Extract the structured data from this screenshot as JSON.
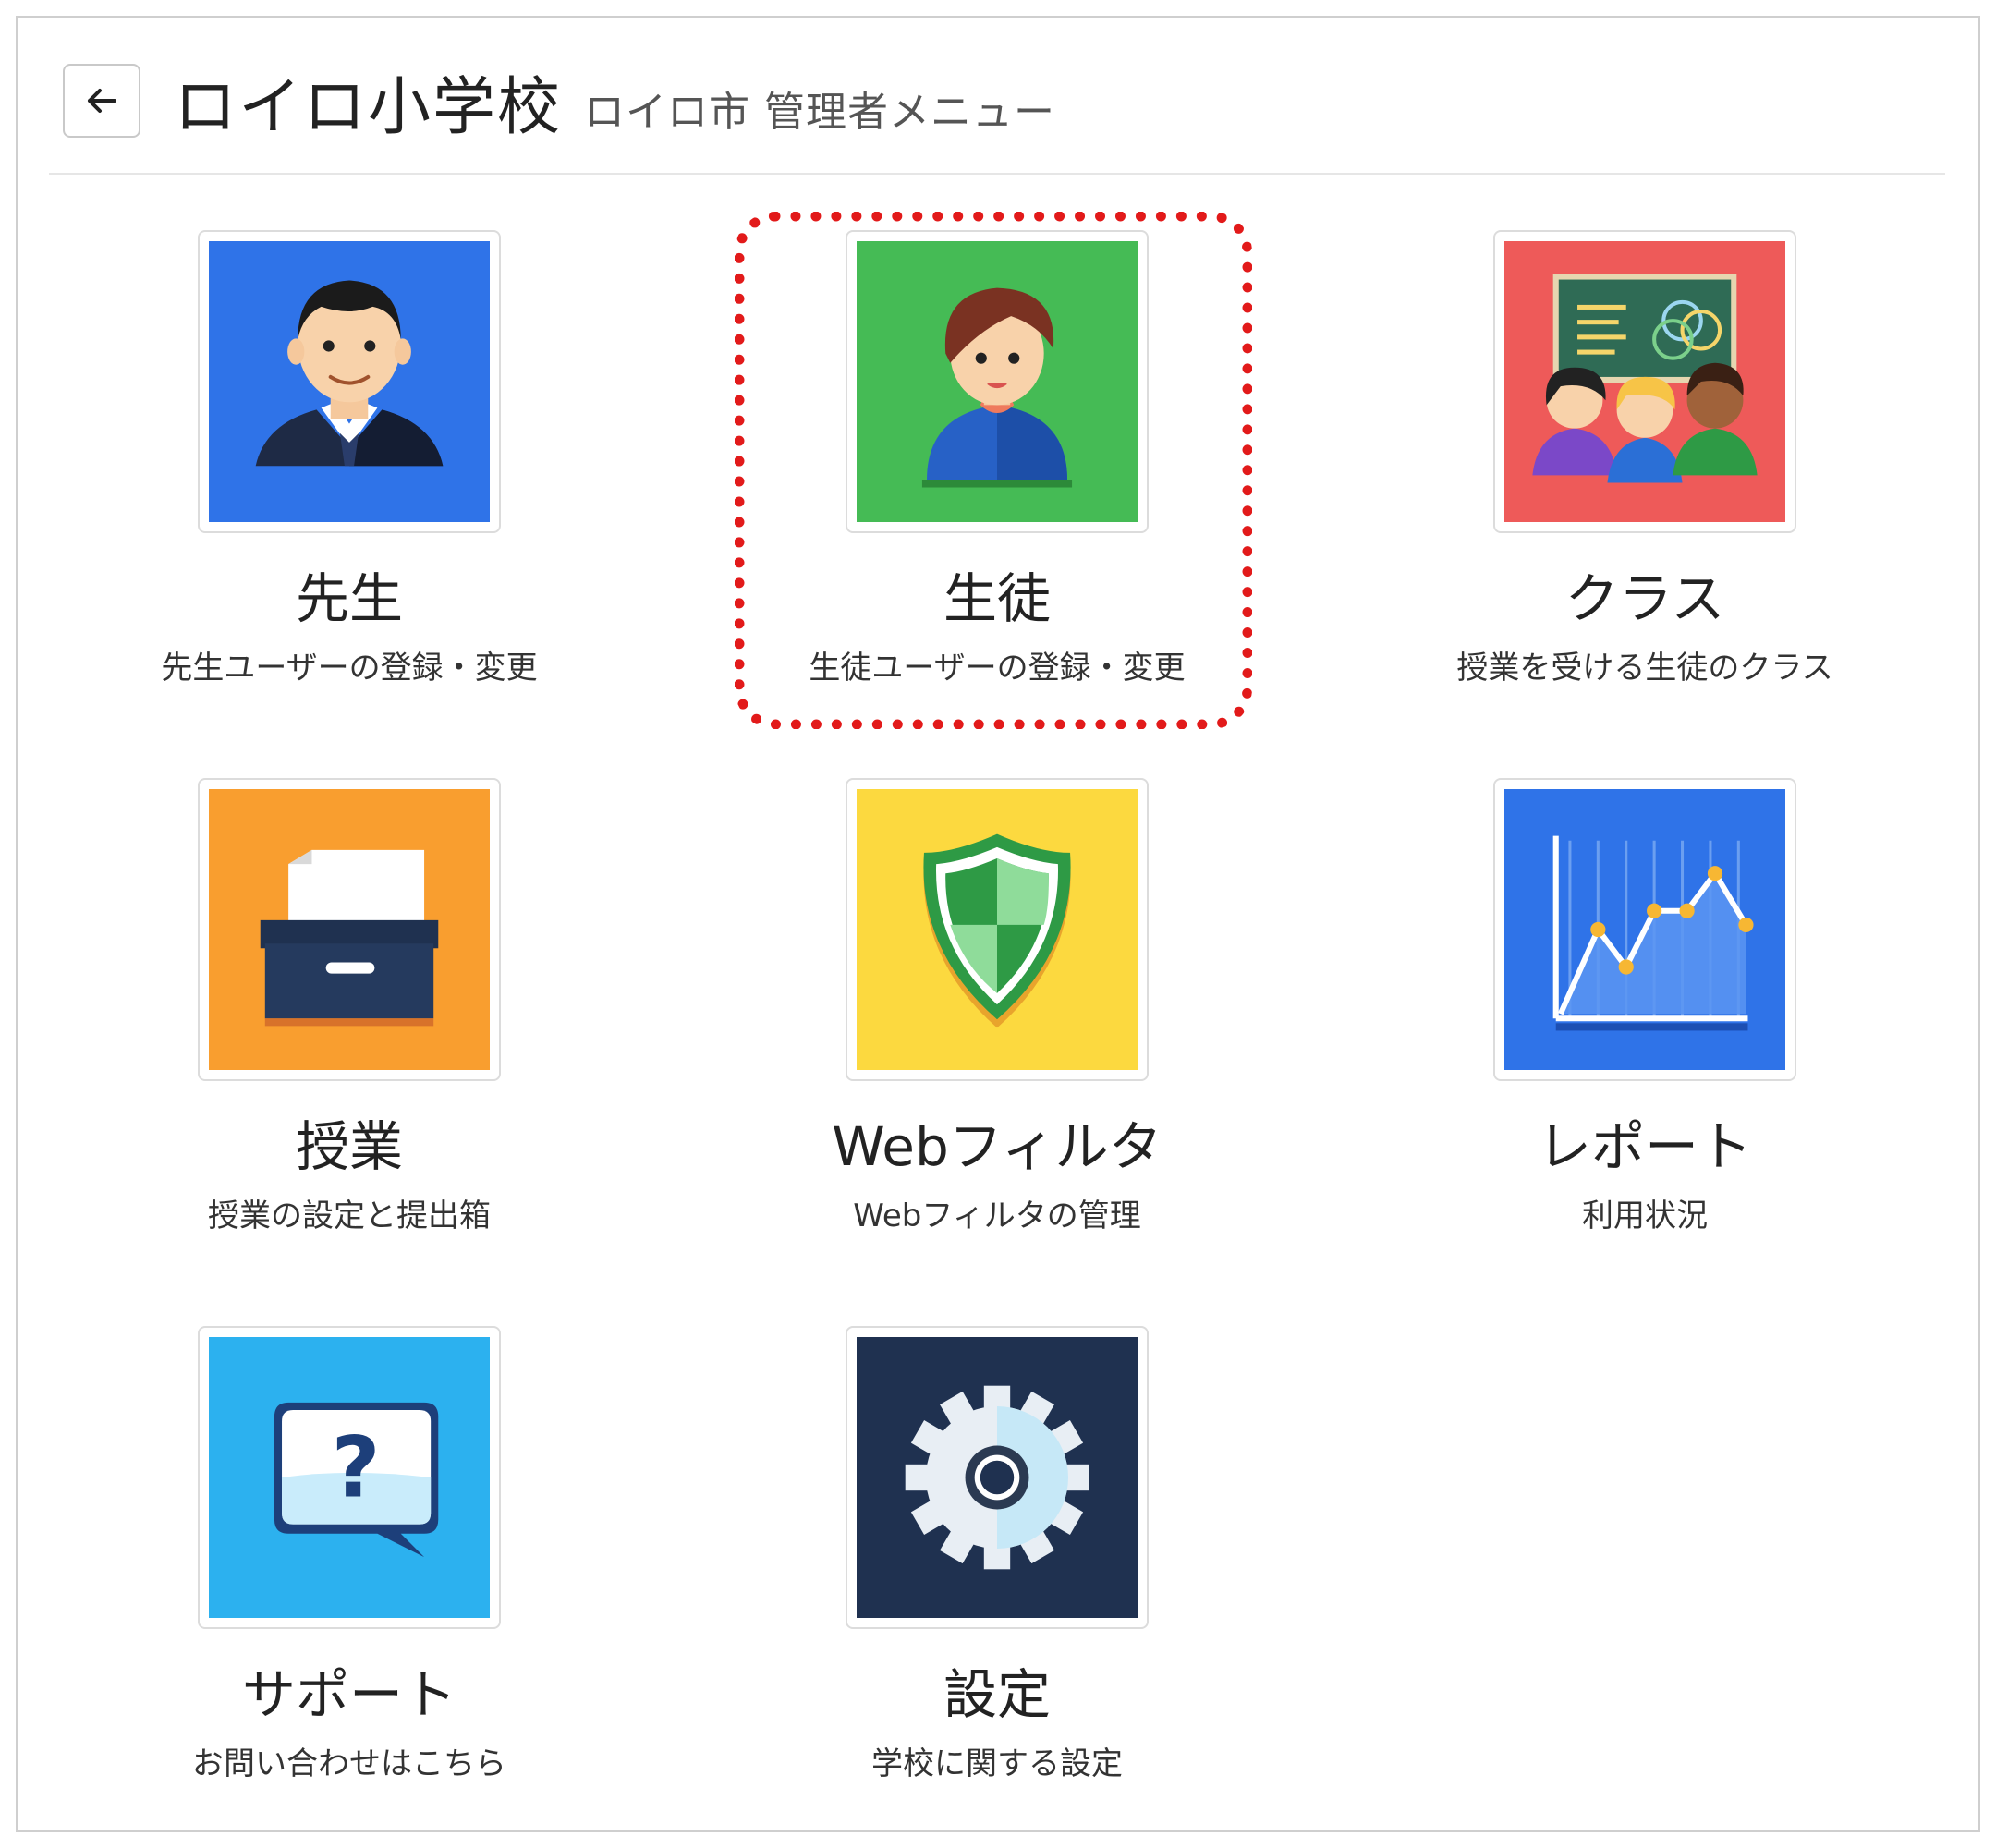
{
  "header": {
    "back_icon": "arrow-left-icon",
    "title": "ロイロ小学校",
    "subtitle": "ロイロ市 管理者メニュー"
  },
  "colors": {
    "teacher": "#2f73e8",
    "student": "#45bb55",
    "class": "#ee5a59",
    "lesson": "#f99e2f",
    "webfilter": "#fcd93f",
    "report": "#2f73e8",
    "support": "#2cb1ef",
    "settings": "#1f3150",
    "highlight": "#e21a1a"
  },
  "menu": [
    {
      "key": "teacher",
      "label": "先生",
      "desc": "先生ユーザーの登録・変更",
      "icon": "teacher-icon"
    },
    {
      "key": "student",
      "label": "生徒",
      "desc": "生徒ユーザーの登録・変更",
      "icon": "student-icon",
      "highlighted": true
    },
    {
      "key": "class",
      "label": "クラス",
      "desc": "授業を受ける生徒のクラス",
      "icon": "class-icon"
    },
    {
      "key": "lesson",
      "label": "授業",
      "desc": "授業の設定と提出箱",
      "icon": "file-box-icon"
    },
    {
      "key": "webfilter",
      "label": "Webフィルタ",
      "desc": "Webフィルタの管理",
      "icon": "shield-icon"
    },
    {
      "key": "report",
      "label": "レポート",
      "desc": "利用状況",
      "icon": "line-chart-icon"
    },
    {
      "key": "support",
      "label": "サポート",
      "desc": "お問い合わせはこちら",
      "icon": "question-bubble-icon"
    },
    {
      "key": "settings",
      "label": "設定",
      "desc": "学校に関する設定",
      "icon": "gear-icon"
    }
  ]
}
